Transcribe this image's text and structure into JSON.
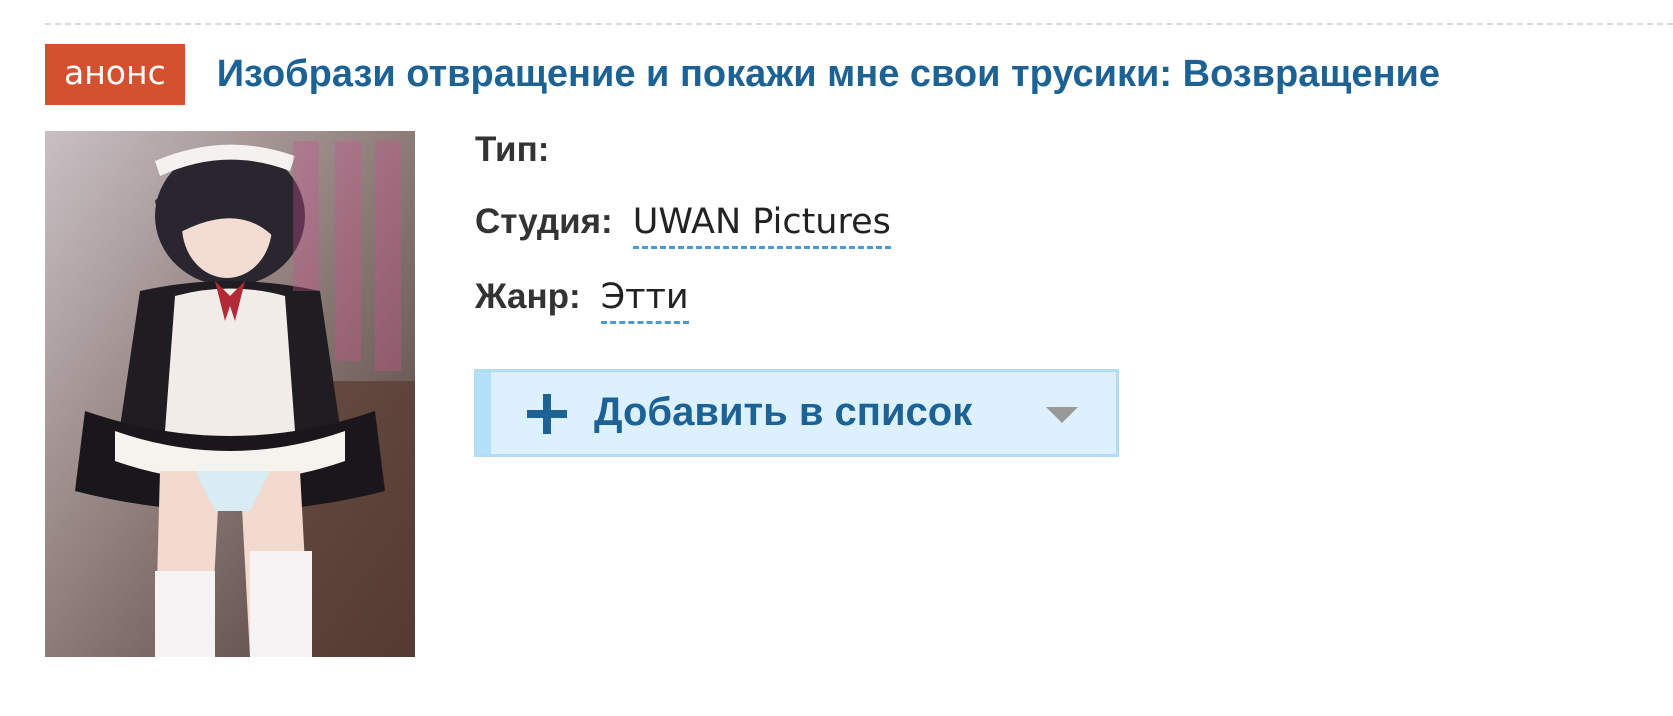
{
  "header": {
    "badge": "анонс",
    "title": "Изобрази отвращение и покажи мне свои трусики: Возвращение"
  },
  "info": {
    "type_label": "Тип:",
    "studio_label": "Студия:",
    "studio_value": "UWAN Pictures",
    "genre_label": "Жанр:",
    "genre_value": "Этти"
  },
  "actions": {
    "add_to_list_label": "Добавить в список",
    "plus_icon": "plus-icon",
    "dropdown_icon": "caret-down-icon"
  },
  "colors": {
    "badge_bg": "#d4512f",
    "title": "#1d6295",
    "button_bg": "#dcf1fd",
    "link_underline": "#4b9ad8"
  }
}
